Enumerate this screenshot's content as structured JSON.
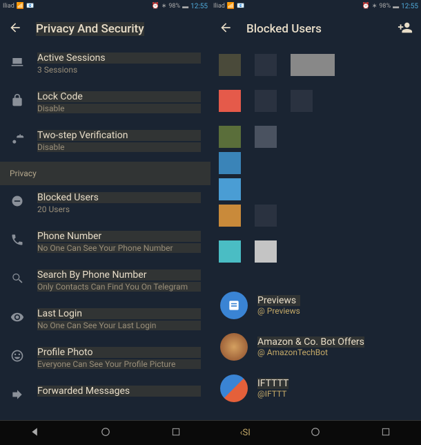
{
  "status": {
    "carrier": "Iliad",
    "battery": "98%",
    "time": "12:55"
  },
  "left": {
    "title": "Privacy And Security",
    "items": {
      "sessions": {
        "title": "Active Sessions",
        "sub": "3 Sessions"
      },
      "lock": {
        "title": "Lock Code",
        "sub": "Disable"
      },
      "twostep": {
        "title": "Two-step Verification",
        "sub": "Disable"
      },
      "section": "Privacy",
      "blocked": {
        "title": "Blocked Users",
        "sub": "20 Users"
      },
      "phone": {
        "title": "Phone Number",
        "sub": "No One Can See Your Phone Number"
      },
      "search": {
        "title": "Search By Phone Number",
        "sub": "Only Contacts Can Find You On Telegram"
      },
      "lastlogin": {
        "title": "Last Login",
        "sub": "No One Can See Your Last Login"
      },
      "photo": {
        "title": "Profile Photo",
        "sub": "Everyone Can See Your Profile Picture"
      },
      "forwarded": {
        "title": "Forwarded Messages"
      }
    }
  },
  "right": {
    "title": "Blocked Users",
    "colors": {
      "r1c1": "#4a4a3a",
      "r1c2": "#2a3240",
      "r1c3": "#888888",
      "r2c1": "#e55a4a",
      "r2c2": "#2a3240",
      "r2c3": "#2a3240",
      "r3c1": "#5a6e3a",
      "r3c2": "#4a5260",
      "r3b1": "#3a84b8",
      "r3c1b": "#4a9dd4",
      "r4c1": "#c98a3a",
      "r4c2": "#2a3240",
      "r5c1": "#4abdc4",
      "r5c2": "#c4c4c4"
    },
    "users": {
      "previews": {
        "name": "Previews",
        "handle": "@ Previews",
        "color": "#3a84d4"
      },
      "amazon": {
        "name": "Amazon & Co. Bot Offers",
        "handle": "@ AmazonTechBot"
      },
      "ifttt": {
        "name": "IFTTTT",
        "handle": "@IFTTT"
      }
    }
  },
  "nav": {
    "sel": "‹SI"
  }
}
